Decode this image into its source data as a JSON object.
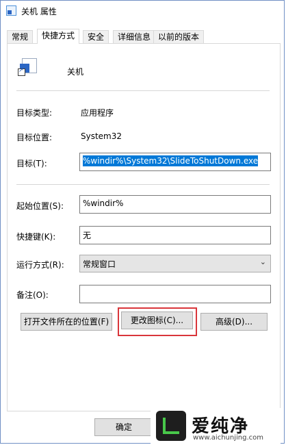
{
  "window": {
    "title": "关机 属性"
  },
  "tabs": [
    {
      "label": "常规"
    },
    {
      "label": "快捷方式",
      "active": true
    },
    {
      "label": "安全"
    },
    {
      "label": "详细信息"
    },
    {
      "label": "以前的版本"
    }
  ],
  "shortcut": {
    "name": "关机",
    "target_type_label": "目标类型:",
    "target_type_value": "应用程序",
    "target_location_label": "目标位置:",
    "target_location_value": "System32",
    "target_label": "目标(T):",
    "target_value": "%windir%\\System32\\SlideToShutDown.exe",
    "start_in_label": "起始位置(S):",
    "start_in_value": "%windir%",
    "hotkey_label": "快捷键(K):",
    "hotkey_value": "无",
    "run_label": "运行方式(R):",
    "run_value": "常规窗口",
    "comment_label": "备注(O):",
    "comment_value": ""
  },
  "buttons": {
    "open_location": "打开文件所在的位置(F)",
    "change_icon": "更改图标(C)...",
    "advanced": "高级(D)...",
    "ok": "确定"
  },
  "watermark": {
    "title": "爱纯净",
    "url": "www.aichunjing.com"
  },
  "colors": {
    "selection": "#0078d7",
    "highlight_box": "#d9353a"
  }
}
